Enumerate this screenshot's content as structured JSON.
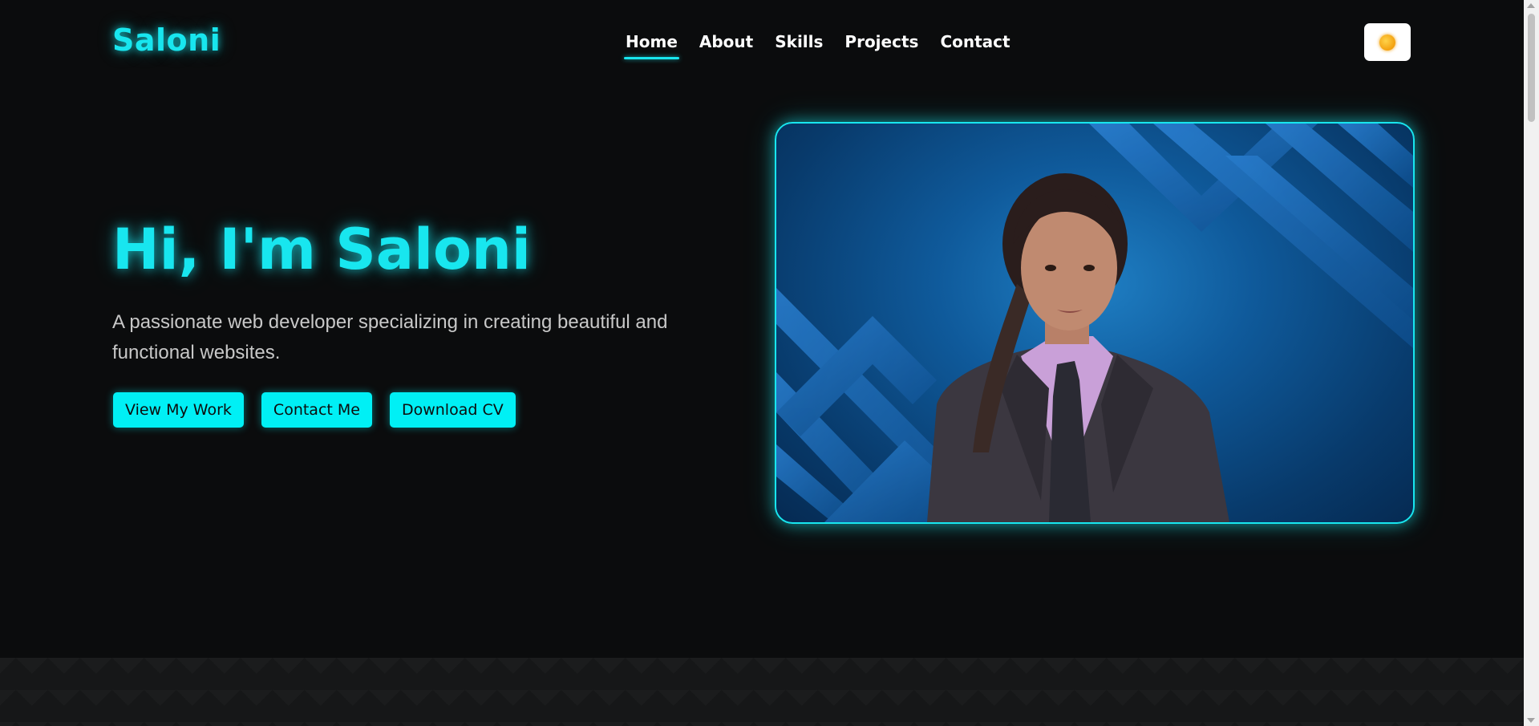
{
  "header": {
    "logo": "Saloni",
    "nav": [
      {
        "label": "Home",
        "active": true
      },
      {
        "label": "About",
        "active": false
      },
      {
        "label": "Skills",
        "active": false
      },
      {
        "label": "Projects",
        "active": false
      },
      {
        "label": "Contact",
        "active": false
      }
    ],
    "theme_toggle_icon": "sun-icon"
  },
  "hero": {
    "title": "Hi, I'm Saloni",
    "subtitle": "A passionate web developer specializing in creating beautiful and functional websites.",
    "buttons": [
      {
        "label": "View My Work"
      },
      {
        "label": "Contact Me"
      },
      {
        "label": "Download CV"
      }
    ]
  },
  "colors": {
    "accent": "#18e6ef",
    "background": "#0b0c0d",
    "button_bg": "#00f0f5"
  }
}
